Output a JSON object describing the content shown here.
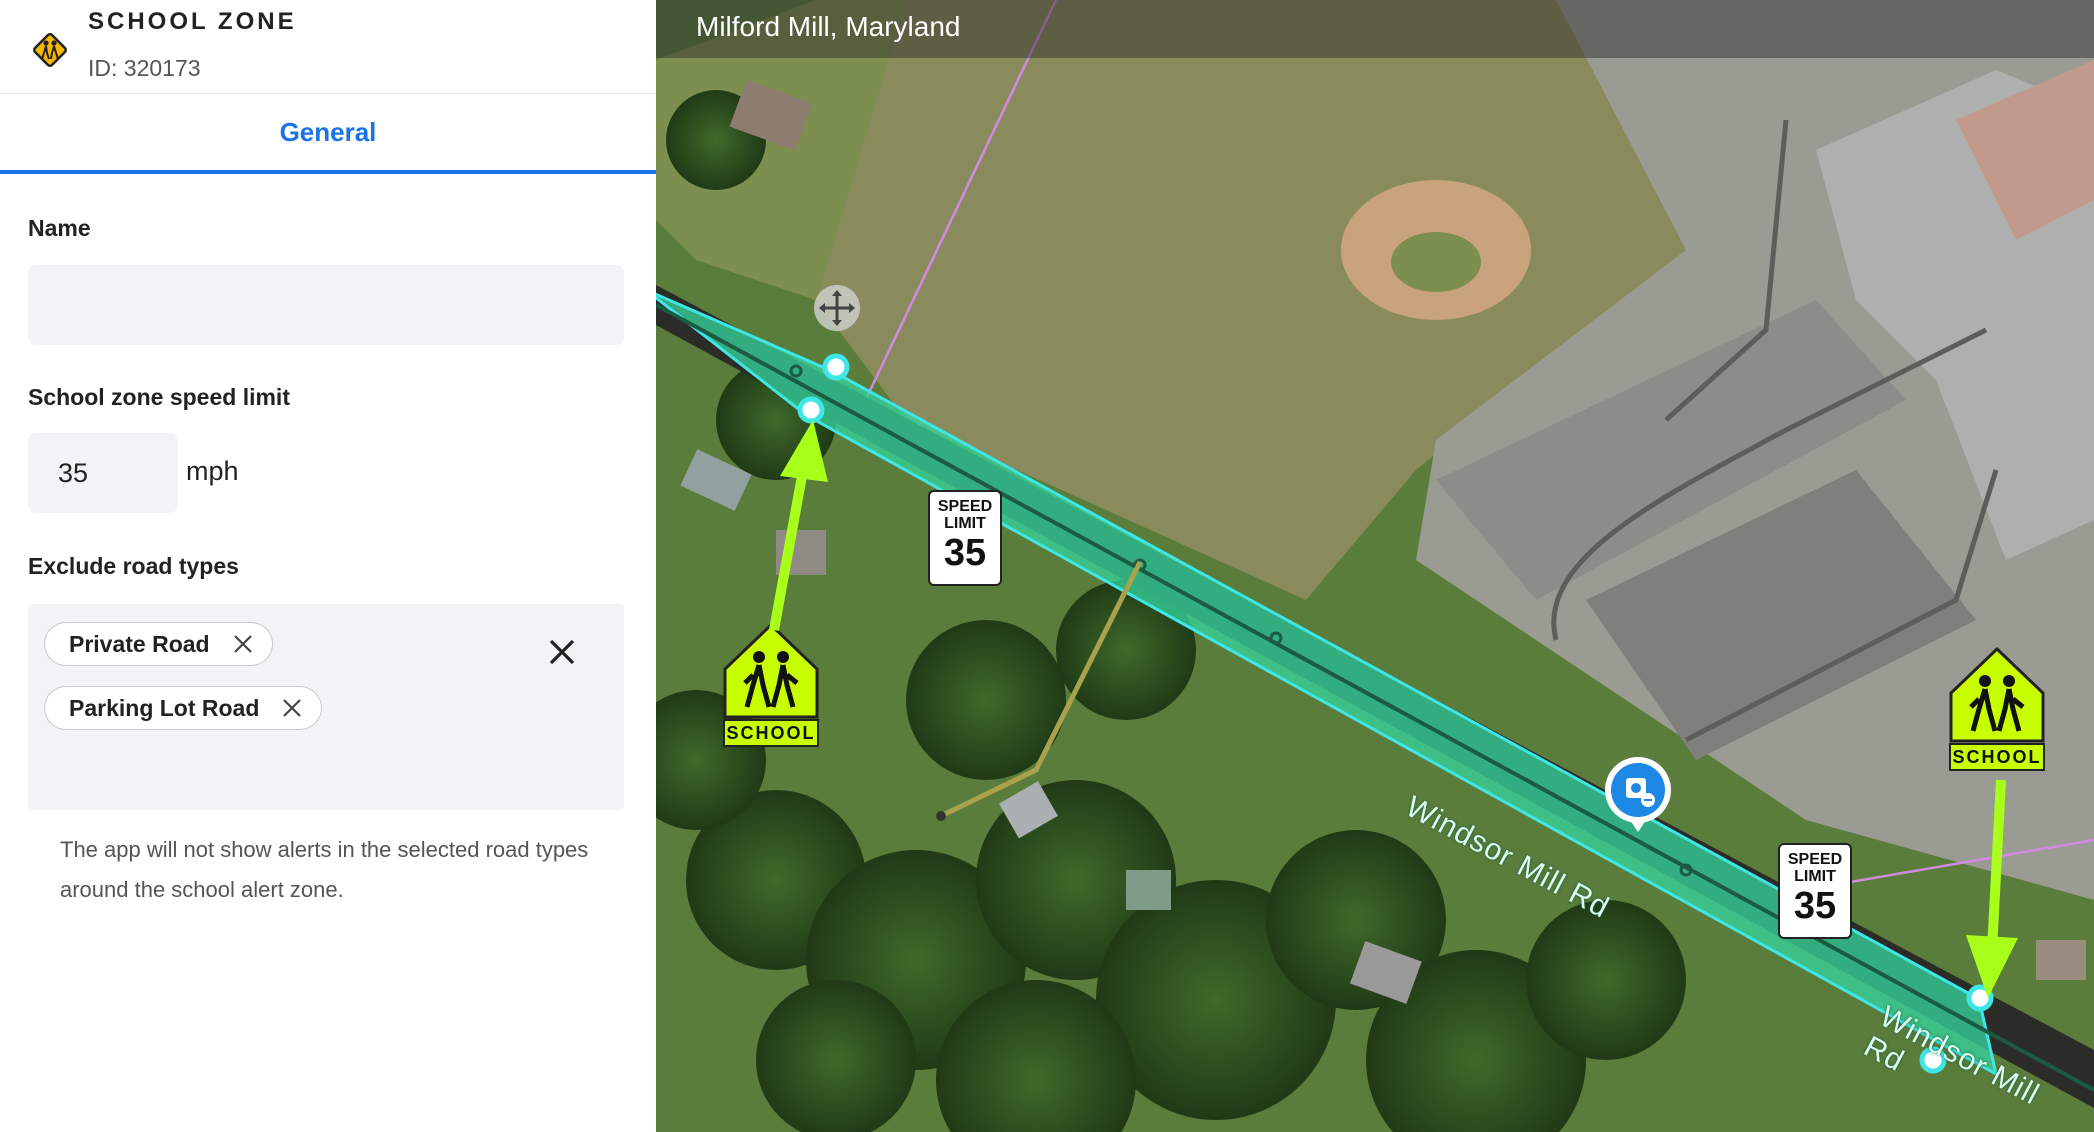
{
  "header": {
    "title": "SCHOOL ZONE",
    "id_label": "ID: 320173",
    "icon": "school-crossing-icon"
  },
  "tabs": [
    {
      "label": "General",
      "active": true
    }
  ],
  "form": {
    "name_label": "Name",
    "name_value": "",
    "speed_label": "School zone speed limit",
    "speed_value": "35",
    "speed_unit": "mph",
    "exclude_label": "Exclude road types",
    "exclude_chips": [
      "Private Road",
      "Parking Lot Road"
    ],
    "help_text": "The app will not show alerts in the selected road types around the school alert zone."
  },
  "map": {
    "location_title": "Milford Mill, Maryland",
    "road_label": "Windsor Mill Rd",
    "signs": {
      "speed_limit_top": "SPEED",
      "speed_limit_bottom": "LIMIT",
      "speed_limit_value": "35",
      "school_label": "SCHOOL"
    }
  },
  "colors": {
    "accent": "#1a73e8",
    "zone_fill": "#35d29a",
    "zone_stroke": "#3fe6e6",
    "school_sign": "#c8ff00",
    "arrow": "#a8ff1a"
  }
}
